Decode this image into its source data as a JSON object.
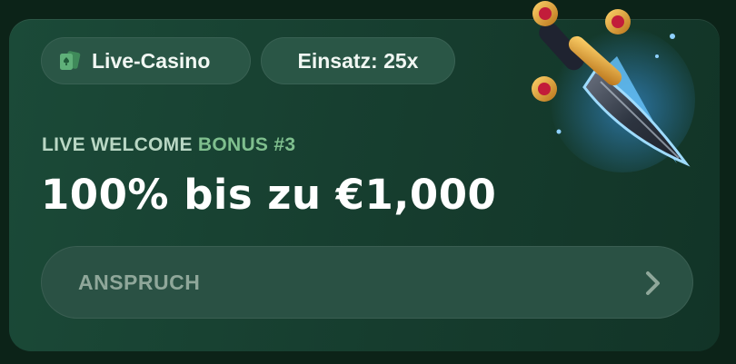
{
  "chips": {
    "category_icon": "cards-icon",
    "category_label": "Live-Casino",
    "wager_label": "Einsatz: 25x"
  },
  "offer": {
    "eyebrow_prefix": "LIVE WELCOME ",
    "eyebrow_accent": "BONUS #3",
    "headline": "100% bis zu €1,000"
  },
  "cta": {
    "label": "ANSPRUCH",
    "icon": "chevron-right-icon"
  },
  "illustration": {
    "icon": "dagger-icon"
  },
  "colors": {
    "card_bg": "#1b4a38",
    "chip_bg": "#2a5646",
    "eyebrow": "#b9d7c4",
    "eyebrow_accent": "#7fbf8e",
    "headline": "#ffffff",
    "cta_text": "#8fa79a"
  }
}
